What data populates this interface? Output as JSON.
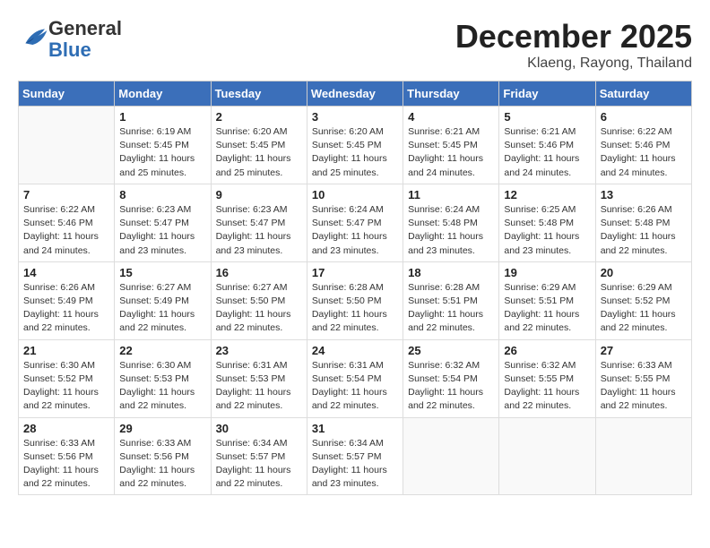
{
  "header": {
    "logo_line1": "General",
    "logo_line2": "Blue",
    "month": "December 2025",
    "location": "Klaeng, Rayong, Thailand"
  },
  "weekdays": [
    "Sunday",
    "Monday",
    "Tuesday",
    "Wednesday",
    "Thursday",
    "Friday",
    "Saturday"
  ],
  "weeks": [
    [
      {
        "day": "",
        "info": ""
      },
      {
        "day": "1",
        "info": "Sunrise: 6:19 AM\nSunset: 5:45 PM\nDaylight: 11 hours\nand 25 minutes."
      },
      {
        "day": "2",
        "info": "Sunrise: 6:20 AM\nSunset: 5:45 PM\nDaylight: 11 hours\nand 25 minutes."
      },
      {
        "day": "3",
        "info": "Sunrise: 6:20 AM\nSunset: 5:45 PM\nDaylight: 11 hours\nand 25 minutes."
      },
      {
        "day": "4",
        "info": "Sunrise: 6:21 AM\nSunset: 5:45 PM\nDaylight: 11 hours\nand 24 minutes."
      },
      {
        "day": "5",
        "info": "Sunrise: 6:21 AM\nSunset: 5:46 PM\nDaylight: 11 hours\nand 24 minutes."
      },
      {
        "day": "6",
        "info": "Sunrise: 6:22 AM\nSunset: 5:46 PM\nDaylight: 11 hours\nand 24 minutes."
      }
    ],
    [
      {
        "day": "7",
        "info": "Sunrise: 6:22 AM\nSunset: 5:46 PM\nDaylight: 11 hours\nand 24 minutes."
      },
      {
        "day": "8",
        "info": "Sunrise: 6:23 AM\nSunset: 5:47 PM\nDaylight: 11 hours\nand 23 minutes."
      },
      {
        "day": "9",
        "info": "Sunrise: 6:23 AM\nSunset: 5:47 PM\nDaylight: 11 hours\nand 23 minutes."
      },
      {
        "day": "10",
        "info": "Sunrise: 6:24 AM\nSunset: 5:47 PM\nDaylight: 11 hours\nand 23 minutes."
      },
      {
        "day": "11",
        "info": "Sunrise: 6:24 AM\nSunset: 5:48 PM\nDaylight: 11 hours\nand 23 minutes."
      },
      {
        "day": "12",
        "info": "Sunrise: 6:25 AM\nSunset: 5:48 PM\nDaylight: 11 hours\nand 23 minutes."
      },
      {
        "day": "13",
        "info": "Sunrise: 6:26 AM\nSunset: 5:48 PM\nDaylight: 11 hours\nand 22 minutes."
      }
    ],
    [
      {
        "day": "14",
        "info": "Sunrise: 6:26 AM\nSunset: 5:49 PM\nDaylight: 11 hours\nand 22 minutes."
      },
      {
        "day": "15",
        "info": "Sunrise: 6:27 AM\nSunset: 5:49 PM\nDaylight: 11 hours\nand 22 minutes."
      },
      {
        "day": "16",
        "info": "Sunrise: 6:27 AM\nSunset: 5:50 PM\nDaylight: 11 hours\nand 22 minutes."
      },
      {
        "day": "17",
        "info": "Sunrise: 6:28 AM\nSunset: 5:50 PM\nDaylight: 11 hours\nand 22 minutes."
      },
      {
        "day": "18",
        "info": "Sunrise: 6:28 AM\nSunset: 5:51 PM\nDaylight: 11 hours\nand 22 minutes."
      },
      {
        "day": "19",
        "info": "Sunrise: 6:29 AM\nSunset: 5:51 PM\nDaylight: 11 hours\nand 22 minutes."
      },
      {
        "day": "20",
        "info": "Sunrise: 6:29 AM\nSunset: 5:52 PM\nDaylight: 11 hours\nand 22 minutes."
      }
    ],
    [
      {
        "day": "21",
        "info": "Sunrise: 6:30 AM\nSunset: 5:52 PM\nDaylight: 11 hours\nand 22 minutes."
      },
      {
        "day": "22",
        "info": "Sunrise: 6:30 AM\nSunset: 5:53 PM\nDaylight: 11 hours\nand 22 minutes."
      },
      {
        "day": "23",
        "info": "Sunrise: 6:31 AM\nSunset: 5:53 PM\nDaylight: 11 hours\nand 22 minutes."
      },
      {
        "day": "24",
        "info": "Sunrise: 6:31 AM\nSunset: 5:54 PM\nDaylight: 11 hours\nand 22 minutes."
      },
      {
        "day": "25",
        "info": "Sunrise: 6:32 AM\nSunset: 5:54 PM\nDaylight: 11 hours\nand 22 minutes."
      },
      {
        "day": "26",
        "info": "Sunrise: 6:32 AM\nSunset: 5:55 PM\nDaylight: 11 hours\nand 22 minutes."
      },
      {
        "day": "27",
        "info": "Sunrise: 6:33 AM\nSunset: 5:55 PM\nDaylight: 11 hours\nand 22 minutes."
      }
    ],
    [
      {
        "day": "28",
        "info": "Sunrise: 6:33 AM\nSunset: 5:56 PM\nDaylight: 11 hours\nand 22 minutes."
      },
      {
        "day": "29",
        "info": "Sunrise: 6:33 AM\nSunset: 5:56 PM\nDaylight: 11 hours\nand 22 minutes."
      },
      {
        "day": "30",
        "info": "Sunrise: 6:34 AM\nSunset: 5:57 PM\nDaylight: 11 hours\nand 22 minutes."
      },
      {
        "day": "31",
        "info": "Sunrise: 6:34 AM\nSunset: 5:57 PM\nDaylight: 11 hours\nand 23 minutes."
      },
      {
        "day": "",
        "info": ""
      },
      {
        "day": "",
        "info": ""
      },
      {
        "day": "",
        "info": ""
      }
    ]
  ]
}
